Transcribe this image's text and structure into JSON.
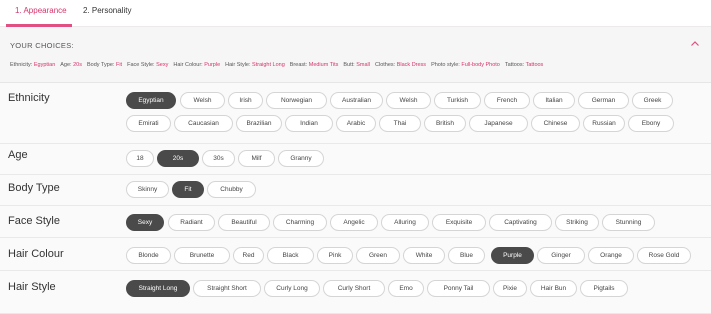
{
  "tabs": [
    "1. Appearance",
    "2. Personality"
  ],
  "choices": {
    "title": "YOUR CHOICES:",
    "items": [
      {
        "label": "Ethnicity:",
        "value": "Egyptian"
      },
      {
        "label": "Age:",
        "value": "20s"
      },
      {
        "label": "Body Type:",
        "value": "Fit"
      },
      {
        "label": "Face Style:",
        "value": "Sexy"
      },
      {
        "label": "Hair Colour:",
        "value": "Purple"
      },
      {
        "label": "Hair Style:",
        "value": "Straight Long"
      },
      {
        "label": "Breast:",
        "value": "Medium Tits"
      },
      {
        "label": "Butt:",
        "value": "Small"
      },
      {
        "label": "Clothes:",
        "value": "Black Dress"
      },
      {
        "label": "Photo style:",
        "value": "Full-body Photo"
      },
      {
        "label": "Tattoos:",
        "value": "Tattoos"
      }
    ]
  },
  "sections": {
    "ethnicity": {
      "label": "Ethnicity",
      "options": [
        "Egyptian",
        "Welsh",
        "Irish",
        "Norwegian",
        "Australian",
        "Welsh",
        "Turkish",
        "French",
        "Italian",
        "German",
        "Greek",
        "Emirati",
        "Caucasian",
        "Brazilian",
        "Indian",
        "Arabic",
        "Thai",
        "British",
        "Japanese",
        "Chinese",
        "Russian",
        "Ebony"
      ],
      "selected": 0
    },
    "age": {
      "label": "Age",
      "options": [
        "18",
        "20s",
        "30s",
        "Milf",
        "Granny"
      ],
      "selected": 1
    },
    "body_type": {
      "label": "Body Type",
      "options": [
        "Skinny",
        "Fit",
        "Chubby"
      ],
      "selected": 1
    },
    "face_style": {
      "label": "Face Style",
      "options": [
        "Sexy",
        "Radiant",
        "Beautiful",
        "Charming",
        "Angelic",
        "Alluring",
        "Exquisite",
        "Captivating",
        "Striking",
        "Stunning"
      ],
      "selected": 0
    },
    "hair_colour": {
      "label": "Hair Colour",
      "options": [
        "Blonde",
        "Brunette",
        "Red",
        "Black",
        "Pink",
        "Green",
        "White",
        "Blue",
        "Purple",
        "Ginger",
        "Orange",
        "Rose Gold"
      ],
      "selected": 8
    },
    "hair_style": {
      "label": "Hair Style",
      "options": [
        "Straight Long",
        "Straight Short",
        "Curly Long",
        "Curly Short",
        "Emo",
        "Ponny Tail",
        "Pixie",
        "Hair Bun",
        "Pigtails"
      ],
      "selected": 0
    }
  },
  "colors": {
    "accent": "#e05082",
    "selected": "#4a4a4a"
  }
}
